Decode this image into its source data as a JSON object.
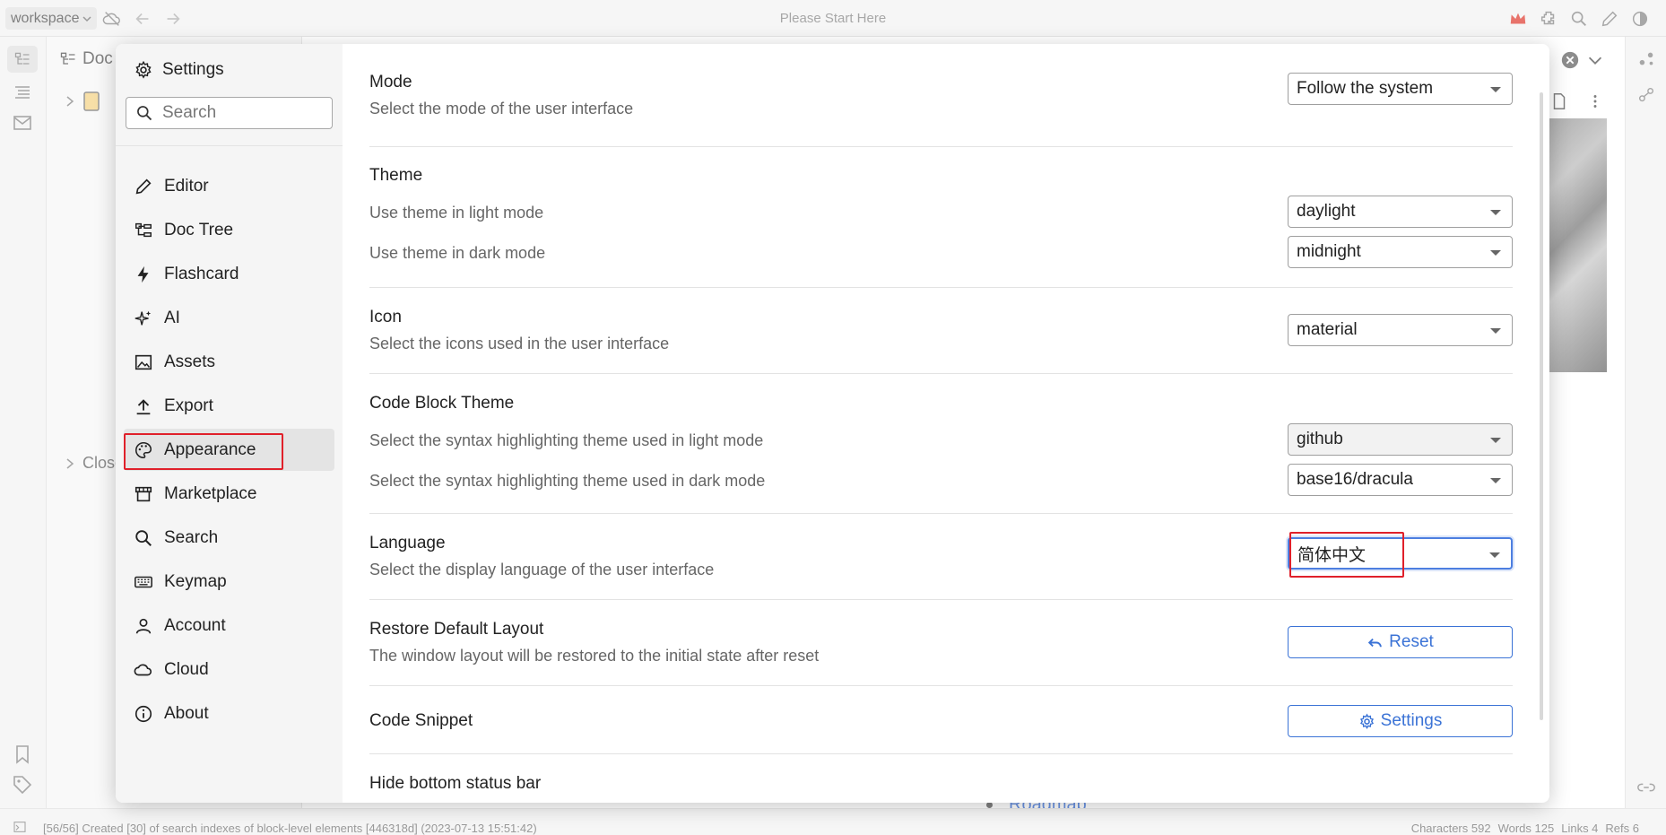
{
  "topbar": {
    "workspace_label": "workspace",
    "title": "Please Start Here"
  },
  "tree": {
    "header": "Doc",
    "closed_label": "Close"
  },
  "editor": {
    "link_text": "Roadmap"
  },
  "statusbar": {
    "message": "[56/56] Created [30] of search indexes of block-level elements [446318d] (2023-07-13 15:51:42)",
    "characters": "Characters 592",
    "words": "Words 125",
    "links": "Links 4",
    "refs": "Refs 6"
  },
  "settings": {
    "title": "Settings",
    "search_placeholder": "Search",
    "nav": [
      {
        "label": "Editor",
        "icon": "pencil-icon"
      },
      {
        "label": "Doc Tree",
        "icon": "doc-tree-icon"
      },
      {
        "label": "Flashcard",
        "icon": "lightning-icon"
      },
      {
        "label": "AI",
        "icon": "sparkle-icon"
      },
      {
        "label": "Assets",
        "icon": "image-icon"
      },
      {
        "label": "Export",
        "icon": "upload-icon"
      },
      {
        "label": "Appearance",
        "icon": "palette-icon"
      },
      {
        "label": "Marketplace",
        "icon": "store-icon"
      },
      {
        "label": "Search",
        "icon": "search-icon"
      },
      {
        "label": "Keymap",
        "icon": "keyboard-icon"
      },
      {
        "label": "Account",
        "icon": "user-icon"
      },
      {
        "label": "Cloud",
        "icon": "cloud-icon"
      },
      {
        "label": "About",
        "icon": "info-icon"
      }
    ],
    "selected_nav": "Appearance",
    "appearance": {
      "mode": {
        "label": "Mode",
        "desc": "Select the mode of the user interface",
        "value": "Follow the system"
      },
      "theme": {
        "label": "Theme",
        "light_desc": "Use theme in light mode",
        "light_value": "daylight",
        "dark_desc": "Use theme in dark mode",
        "dark_value": "midnight"
      },
      "icon": {
        "label": "Icon",
        "desc": "Select the icons used in the user interface",
        "value": "material"
      },
      "code_block_theme": {
        "label": "Code Block Theme",
        "light_desc": "Select the syntax highlighting theme used in light mode",
        "light_value": "github",
        "dark_desc": "Select the syntax highlighting theme used in dark mode",
        "dark_value": "base16/dracula"
      },
      "language": {
        "label": "Language",
        "desc": "Select the display language of the user interface",
        "value": "简体中文"
      },
      "restore_layout": {
        "label": "Restore Default Layout",
        "desc": "The window layout will be restored to the initial state after reset",
        "button": "Reset"
      },
      "code_snippet": {
        "label": "Code Snippet",
        "button": "Settings"
      },
      "hide_status_bar": {
        "label": "Hide bottom status bar"
      }
    }
  },
  "colors": {
    "accent": "#3b73d6",
    "highlight": "#e0202a"
  }
}
